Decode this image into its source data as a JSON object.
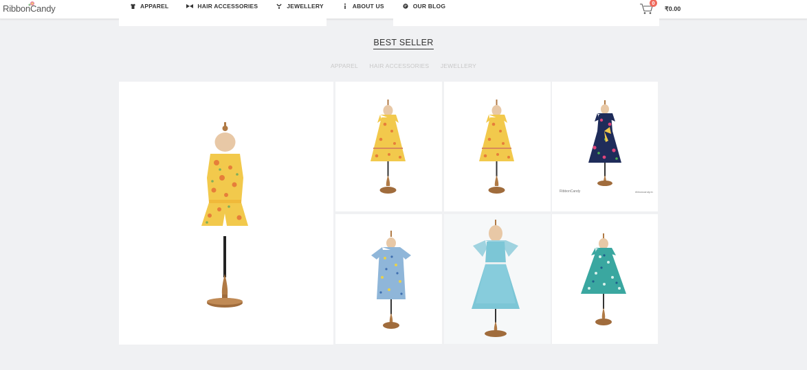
{
  "brand": {
    "name": "RibbonCandy"
  },
  "nav": {
    "items": [
      {
        "label": "APPAREL",
        "icon": "tshirt-icon"
      },
      {
        "label": "HAIR ACCESSORIES",
        "icon": "bow-icon"
      },
      {
        "label": "JEWELLERY",
        "icon": "jewel-icon"
      },
      {
        "label": "ABOUT US",
        "icon": "info-icon"
      },
      {
        "label": "OUR BLOG",
        "icon": "blog-icon"
      }
    ]
  },
  "cart": {
    "count": "0",
    "total": "₹0.00",
    "icon": "cart-icon"
  },
  "section": {
    "title": "BEST SELLER",
    "filters": [
      "APPAREL",
      "HAIR ACCESSORIES",
      "JEWELLERY"
    ]
  },
  "products": [
    {
      "image": "yellow floral top and shorts on mannequin"
    },
    {
      "image": "yellow floral dress on mannequin"
    },
    {
      "image": "yellow floral dress on mannequin"
    },
    {
      "image": "navy floral dress on mannequin",
      "watermark_left": "RibbonCandy",
      "watermark_right": "ribboncandy.in"
    },
    {
      "image": "blue floral ruffle top on mannequin"
    },
    {
      "image": "aqua ruffle dress on mannequin"
    },
    {
      "image": "teal floral dress on mannequin"
    }
  ],
  "colors": {
    "background": "#f0f1f3",
    "badge": "#ef6b5e",
    "wood": "#b07a45",
    "yellow_print": "#f2c94c",
    "navy_print": "#1f2c5a",
    "aqua": "#7cc6d6",
    "teal_print": "#3aa7a0"
  }
}
